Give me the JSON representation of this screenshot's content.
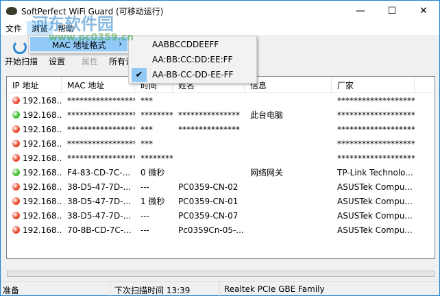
{
  "window": {
    "title": "SoftPerfect WiFi Guard (可移动运行)",
    "minimize": "—",
    "maximize": "☐",
    "close": "✕"
  },
  "menu": [
    "文件",
    "浏览",
    "帮助"
  ],
  "dropdown": {
    "item": "MAC 地址格式",
    "arrow": "›"
  },
  "submenu": {
    "items": [
      "AABBCCDDEEFF",
      "AA:BB:CC:DD:EE:FF",
      "AA-BB-CC-DD-EE-FF"
    ],
    "checked": "✔"
  },
  "toolbar": [
    "开始扫描",
    "设置",
    "属性",
    "所有设备"
  ],
  "columns": [
    "IP 地址",
    "MAC 地址",
    "时间",
    "姓名",
    "信息",
    "厂家"
  ],
  "rows": [
    {
      "status": "red",
      "ip": "192.168...",
      "mac": "*****************",
      "time": "***",
      "name": "",
      "info": "",
      "vendor": "*******************..."
    },
    {
      "status": "green",
      "ip": "192.168...",
      "mac": "*****************",
      "time": "********",
      "name": "***************",
      "info": "此台电脑",
      "vendor": "*******************..."
    },
    {
      "status": "red",
      "ip": "192.168...",
      "mac": "*****************",
      "time": "***",
      "name": "***************",
      "info": "",
      "vendor": "*******************..."
    },
    {
      "status": "red",
      "ip": "192.168...",
      "mac": "*****************",
      "time": "***",
      "name": "",
      "info": "",
      "vendor": "*******************..."
    },
    {
      "status": "red",
      "ip": "192.168...",
      "mac": "*****************",
      "time": "********",
      "name": "",
      "info": "",
      "vendor": "*******************..."
    },
    {
      "status": "green",
      "ip": "192.168...",
      "mac": "F4-83-CD-7C-...",
      "time": "0 微秒",
      "name": "",
      "info": "网络网关",
      "vendor": "TP-Link Technolo..."
    },
    {
      "status": "red",
      "ip": "192.168...",
      "mac": "38-D5-47-7D-...",
      "time": "---",
      "name": "PC0359-CN-02",
      "info": "",
      "vendor": "ASUSTek Compu..."
    },
    {
      "status": "red",
      "ip": "192.168...",
      "mac": "38-D5-47-7D-...",
      "time": "1 微秒",
      "name": "PC0359-CN-01",
      "info": "",
      "vendor": "ASUSTek Compu..."
    },
    {
      "status": "red",
      "ip": "192.168...",
      "mac": "38-D5-47-7D-...",
      "time": "---",
      "name": "PC0359-CN-07",
      "info": "",
      "vendor": "ASUSTek Compu..."
    },
    {
      "status": "red",
      "ip": "192.168...",
      "mac": "70-8B-CD-7C-...",
      "time": "---",
      "name": "Pc0359Cn-05-...",
      "info": "",
      "vendor": "ASUSTek Compu..."
    }
  ],
  "colors": {
    "red": "#e8482c",
    "green": "#3fbf2c"
  },
  "progress": 0,
  "statusbar": [
    "准备",
    "下次扫描时间 13:39",
    "Realtek PCIe GBE Family"
  ],
  "watermark": {
    "name": "河东软件园",
    "url": "www.pc0359.cn"
  }
}
